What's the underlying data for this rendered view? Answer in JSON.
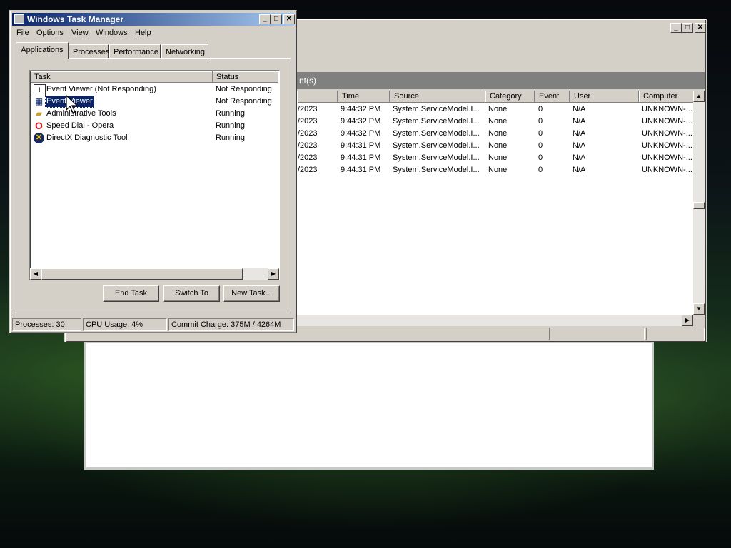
{
  "event_viewer": {
    "pane_header": "nt(s)",
    "columns": [
      "Time",
      "Source",
      "Category",
      "Event",
      "User",
      "Computer"
    ],
    "rows": [
      {
        "date": "/2023",
        "time": "9:44:32 PM",
        "source": "System.ServiceModel.I...",
        "category": "None",
        "event": "0",
        "user": "N/A",
        "computer": "UNKNOWN-..."
      },
      {
        "date": "/2023",
        "time": "9:44:32 PM",
        "source": "System.ServiceModel.I...",
        "category": "None",
        "event": "0",
        "user": "N/A",
        "computer": "UNKNOWN-..."
      },
      {
        "date": "/2023",
        "time": "9:44:32 PM",
        "source": "System.ServiceModel.I...",
        "category": "None",
        "event": "0",
        "user": "N/A",
        "computer": "UNKNOWN-..."
      },
      {
        "date": "/2023",
        "time": "9:44:31 PM",
        "source": "System.ServiceModel.I...",
        "category": "None",
        "event": "0",
        "user": "N/A",
        "computer": "UNKNOWN-..."
      },
      {
        "date": "/2023",
        "time": "9:44:31 PM",
        "source": "System.ServiceModel.I...",
        "category": "None",
        "event": "0",
        "user": "N/A",
        "computer": "UNKNOWN-..."
      },
      {
        "date": "/2023",
        "time": "9:44:31 PM",
        "source": "System.ServiceModel.I...",
        "category": "None",
        "event": "0",
        "user": "N/A",
        "computer": "UNKNOWN-..."
      }
    ]
  },
  "task_manager": {
    "title": "Windows Task Manager",
    "menu": [
      "File",
      "Options",
      "View",
      "Windows",
      "Help"
    ],
    "tabs": [
      "Applications",
      "Processes",
      "Performance",
      "Networking"
    ],
    "active_tab": "Applications",
    "columns": {
      "task": "Task",
      "status": "Status"
    },
    "tasks": [
      {
        "name": "Event Viewer (Not Responding)",
        "status": "Not Responding",
        "icon": "event-viewer-icon"
      },
      {
        "name": "Event Viewer",
        "status": "Not Responding",
        "icon": "event-viewer-icon"
      },
      {
        "name": "Administrative Tools",
        "status": "Running",
        "icon": "folder-tools-icon"
      },
      {
        "name": "Speed Dial - Opera",
        "status": "Running",
        "icon": "opera-icon"
      },
      {
        "name": "DirectX Diagnostic Tool",
        "status": "Running",
        "icon": "directx-icon"
      }
    ],
    "selected_task": "Event Viewer",
    "buttons": {
      "end_task": "End Task",
      "switch_to": "Switch To",
      "new_task": "New Task..."
    },
    "status": {
      "processes": "Processes: 30",
      "cpu": "CPU Usage: 4%",
      "commit": "Commit Charge: 375M / 4264M"
    }
  },
  "colors": {
    "title_active": "#0a246a",
    "selection": "#0a246a",
    "face": "#d4d0c8"
  }
}
